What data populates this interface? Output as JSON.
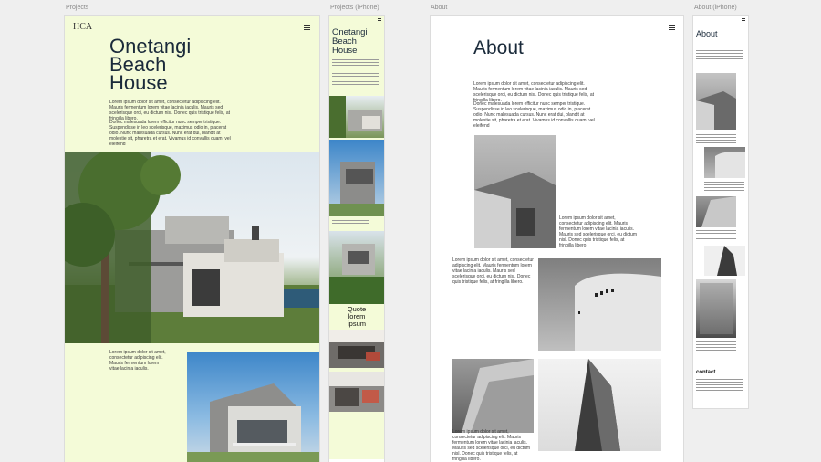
{
  "boards": {
    "projects": {
      "label": "Projects"
    },
    "projects_iphone": {
      "label": "Projects (iPhone)"
    },
    "about": {
      "label": "About"
    },
    "about_iphone": {
      "label": "About (iPhone)"
    }
  },
  "projects": {
    "logo": "HCA",
    "title_lines": [
      "Onetangi",
      "Beach",
      "House"
    ],
    "para1": "Lorem ipsum dolor sit amet, consectetur adipiscing elit. Mauris fermentum lorem vitae lacinia iaculis. Mauris sed scelerisque orci, eu dictum nisl. Donec quis tristique felis, at fringilla libero.",
    "para2": "Donec malesuada lorem efficitur nunc semper tristique. Suspendisse in leo scelerisque, maximus odio in, placerat odio. Nunc malesuada cursus. Nunc erat dui, blandit at molestie sit, pharetra et erat. Vivamus id convallis quam, vel eleifend",
    "para3": "Lorem ipsum dolor sit amet, consectetur adipiscing elit. Mauris fermentum lorem vitae lacinia iaculis."
  },
  "projects_iphone": {
    "title_lines": [
      "Onetangi",
      "Beach",
      "House"
    ],
    "quote_lines": [
      "Quote",
      "lorem",
      "ipsum"
    ]
  },
  "about": {
    "title": "About",
    "para1": "Lorem ipsum dolor sit amet, consectetur adipiscing elit. Mauris fermentum lorem vitae lacinia iaculis. Mauris sed scelerisque orci, eu dictum nisl. Donec quis tristique felis, at fringilla libero.",
    "para2": "Donec malesuada lorem efficitur nunc semper tristique. Suspendisse in leo scelerisque, maximus odio in, placerat odio. Nunc malesuada cursus. Nunc erat dui, blandit at molestie sit, pharetra et erat. Vivamus id convallis quam, vel eleifend",
    "caption1": "Lorem ipsum dolor sit amet, consectetur adipiscing elit. Mauris fermentum lorem vitae lacinia iaculis. Mauris sed scelerisque orci, eu dictum nisl. Donec quis tristique felis, at fringilla libero.",
    "caption2": "Lorem ipsum dolor sit amet, consectetur adipiscing elit. Mauris fermentum lorem vitae lacinia iaculis. Mauris sed scelerisque orci, eu dictum nisl. Donec quis tristique felis, at fringilla libero.",
    "caption3": "Lorem ipsum dolor sit amet, consectetur adipiscing elit. Mauris fermentum lorem vitae lacinia iaculis. Mauris sed scelerisque orci, eu dictum nisl. Donec quis tristique felis, at fringilla libero."
  },
  "about_iphone": {
    "title": "About",
    "contact": "contact"
  },
  "colors": {
    "canvas": "#efefef",
    "projects_bg": "#f4fbd8",
    "artboard_bg": "#ffffff",
    "text": "#1a2a3a"
  }
}
